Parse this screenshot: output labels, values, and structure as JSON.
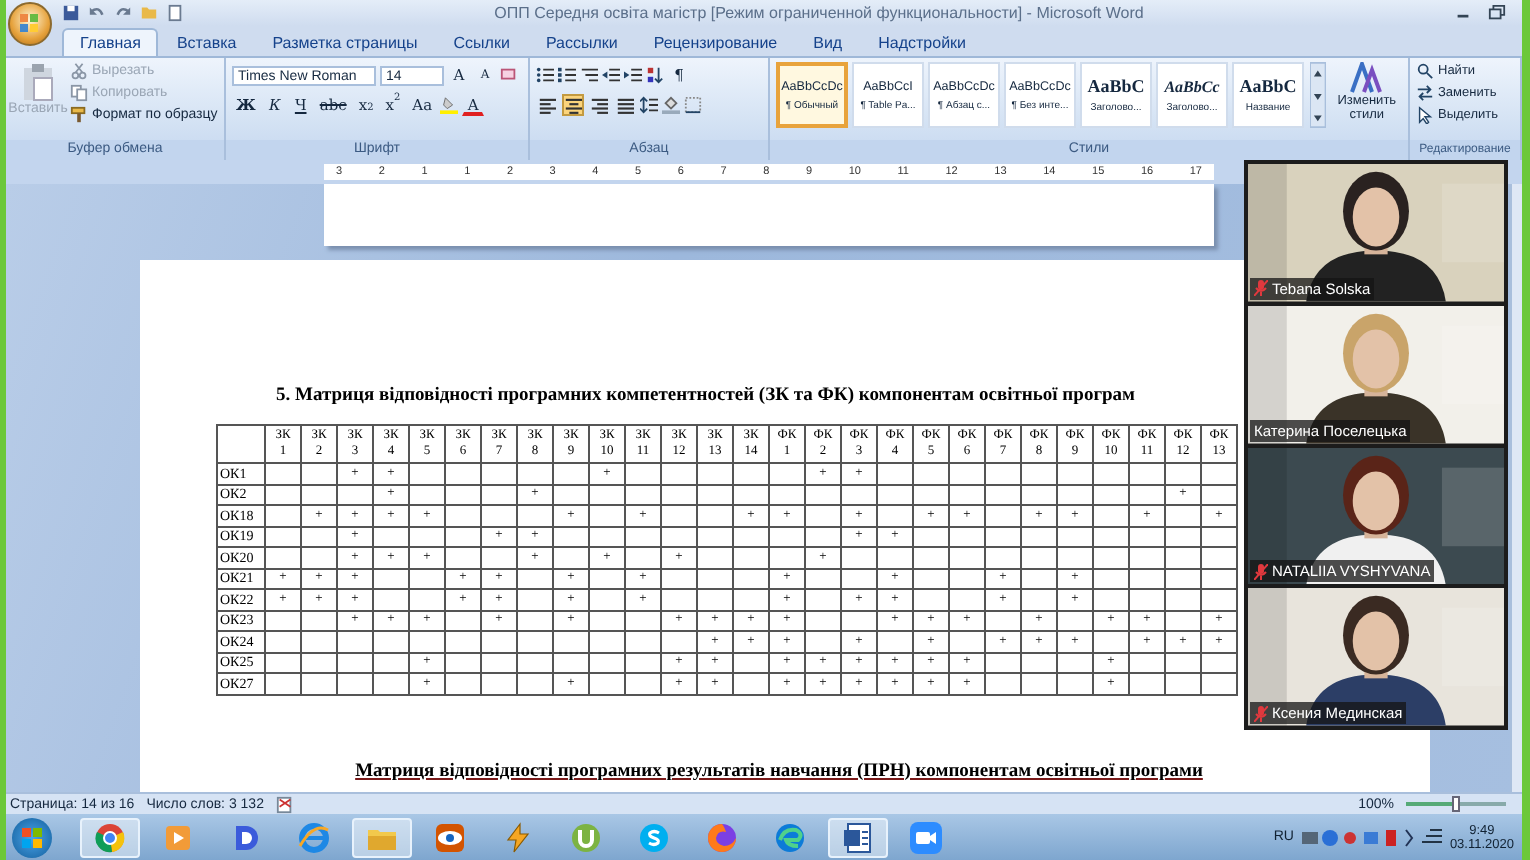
{
  "window": {
    "title": "ОПП Середня освіта магістр [Режим ограниченной функциональности] - Microsoft Word"
  },
  "tabs": [
    {
      "label": "Главная",
      "selected": true
    },
    {
      "label": "Вставка",
      "selected": false
    },
    {
      "label": "Разметка страницы",
      "selected": false
    },
    {
      "label": "Ссылки",
      "selected": false
    },
    {
      "label": "Рассылки",
      "selected": false
    },
    {
      "label": "Рецензирование",
      "selected": false
    },
    {
      "label": "Вид",
      "selected": false
    },
    {
      "label": "Надстройки",
      "selected": false
    }
  ],
  "ribbon": {
    "clipboard": {
      "label": "Буфер обмена",
      "items": [
        {
          "kind": "paste",
          "label": "Вставить",
          "disabled": true
        },
        {
          "kind": "cut",
          "label": "Вырезать",
          "disabled": true
        },
        {
          "kind": "copy",
          "label": "Копировать",
          "disabled": true
        },
        {
          "kind": "painter",
          "label": "Формат по образцу",
          "disabled": false
        }
      ]
    },
    "font": {
      "label": "Шрифт",
      "font_name": "Times New Roman",
      "font_size": "14",
      "grow": "A",
      "shrink": "A",
      "buttons": [
        {
          "kind": "bold",
          "text": "Ж"
        },
        {
          "kind": "italic",
          "text": "К"
        },
        {
          "kind": "underline",
          "text": "Ч"
        },
        {
          "kind": "strike",
          "text": "abc"
        },
        {
          "kind": "sub",
          "text": "x$_{2}$"
        },
        {
          "kind": "sup",
          "text": "x$^{2}$"
        },
        {
          "kind": "case",
          "text": "Aa"
        }
      ],
      "font_color": "A"
    },
    "paragraph": {
      "label": "Абзац",
      "pilcrow": "¶",
      "alignment": [
        {
          "kind": "left",
          "selected": false
        },
        {
          "kind": "center",
          "selected": true
        },
        {
          "kind": "right",
          "selected": false
        },
        {
          "kind": "justify",
          "selected": false
        }
      ]
    },
    "styles": {
      "label": "Стили",
      "items": [
        {
          "preview": "AaBbCcDc",
          "name": "¶ Обычный",
          "kind": "body",
          "selected": true
        },
        {
          "preview": "AaBbCcI",
          "name": "¶ Table Pa...",
          "kind": "body",
          "selected": false
        },
        {
          "preview": "AaBbCcDc",
          "name": "¶ Абзац с...",
          "kind": "body",
          "selected": false
        },
        {
          "preview": "AaBbCcDc",
          "name": "¶ Без инте...",
          "kind": "body",
          "selected": false
        },
        {
          "preview": "AaBbC",
          "name": "Заголово...",
          "kind": "heading",
          "selected": false
        },
        {
          "preview": "AaBbCc",
          "name": "Заголово...",
          "kind": "heading-italic",
          "selected": false
        },
        {
          "preview": "AaBbC",
          "name": "Название",
          "kind": "heading",
          "selected": false
        }
      ],
      "change_styles": "Изменить стили"
    },
    "editing": {
      "label": "Редактирование",
      "items": [
        {
          "kind": "find",
          "label": "Найти"
        },
        {
          "kind": "replace",
          "label": "Заменить"
        },
        {
          "kind": "select",
          "label": "Выделить"
        }
      ]
    }
  },
  "ruler": {
    "marks": [
      "3",
      "2",
      "1",
      "1",
      "2",
      "3",
      "4",
      "5",
      "6",
      "7",
      "8",
      "9",
      "10",
      "11",
      "12",
      "13",
      "14",
      "15",
      "16",
      "17"
    ]
  },
  "document": {
    "heading": "5. Матриця відповідності програмних компетентностей (ЗК та ФК) компонентам освітньої програм",
    "table": {
      "columns": [
        {
          "group": "ЗК",
          "number": "1"
        },
        {
          "group": "ЗК",
          "number": "2"
        },
        {
          "group": "ЗК",
          "number": "3"
        },
        {
          "group": "ЗК",
          "number": "4"
        },
        {
          "group": "ЗК",
          "number": "5"
        },
        {
          "group": "ЗК",
          "number": "6"
        },
        {
          "group": "ЗК",
          "number": "7"
        },
        {
          "group": "ЗК",
          "number": "8"
        },
        {
          "group": "ЗК",
          "number": "9"
        },
        {
          "group": "ЗК",
          "number": "10"
        },
        {
          "group": "ЗК",
          "number": "11"
        },
        {
          "group": "ЗК",
          "number": "12"
        },
        {
          "group": "ЗК",
          "number": "13"
        },
        {
          "group": "ЗК",
          "number": "14"
        },
        {
          "group": "ФК",
          "number": "1"
        },
        {
          "group": "ФК",
          "number": "2"
        },
        {
          "group": "ФК",
          "number": "3"
        },
        {
          "group": "ФК",
          "number": "4"
        },
        {
          "group": "ФК",
          "number": "5"
        },
        {
          "group": "ФК",
          "number": "6"
        },
        {
          "group": "ФК",
          "number": "7"
        },
        {
          "group": "ФК",
          "number": "8"
        },
        {
          "group": "ФК",
          "number": "9"
        },
        {
          "group": "ФК",
          "number": "10"
        },
        {
          "group": "ФК",
          "number": "11"
        },
        {
          "group": "ФК",
          "number": "12"
        },
        {
          "group": "ФК",
          "number": "13"
        }
      ],
      "rows": [
        {
          "label": "ОК1",
          "cells": [
            null,
            null,
            "+",
            "+",
            null,
            null,
            null,
            null,
            null,
            "+",
            null,
            null,
            null,
            null,
            null,
            "+",
            "+",
            null,
            null,
            null,
            null,
            null,
            null,
            null,
            null,
            null,
            null
          ]
        },
        {
          "label": "ОК2",
          "cells": [
            null,
            null,
            null,
            "+",
            null,
            null,
            null,
            "+",
            null,
            null,
            null,
            null,
            null,
            null,
            null,
            null,
            null,
            null,
            null,
            null,
            null,
            null,
            null,
            null,
            null,
            "+",
            null
          ]
        },
        {
          "label": "ОК18",
          "cells": [
            null,
            "+",
            "+",
            "+",
            "+",
            null,
            null,
            null,
            "+",
            null,
            "+",
            null,
            null,
            "+",
            "+",
            null,
            "+",
            null,
            "+",
            "+",
            null,
            "+",
            "+",
            null,
            "+",
            null,
            "+"
          ]
        },
        {
          "label": "ОК19",
          "cells": [
            null,
            null,
            "+",
            null,
            null,
            null,
            "+",
            "+",
            null,
            null,
            null,
            null,
            null,
            null,
            null,
            null,
            "+",
            "+",
            null,
            null,
            null,
            null,
            null,
            null,
            null,
            null,
            null
          ]
        },
        {
          "label": "ОК20",
          "cells": [
            null,
            null,
            "+",
            "+",
            "+",
            null,
            null,
            "+",
            null,
            "+",
            null,
            "+",
            null,
            null,
            null,
            "+",
            null,
            null,
            null,
            null,
            null,
            null,
            null,
            null,
            null,
            null,
            null
          ]
        },
        {
          "label": "ОК21",
          "cells": [
            "+",
            "+",
            "+",
            null,
            null,
            "+",
            "+",
            null,
            "+",
            null,
            "+",
            null,
            null,
            null,
            "+",
            null,
            null,
            "+",
            null,
            null,
            "+",
            null,
            "+",
            null,
            null,
            null,
            null
          ]
        },
        {
          "label": "ОК22",
          "cells": [
            "+",
            "+",
            "+",
            null,
            null,
            "+",
            "+",
            null,
            "+",
            null,
            "+",
            null,
            null,
            null,
            "+",
            null,
            "+",
            "+",
            null,
            null,
            "+",
            null,
            "+",
            null,
            null,
            null,
            null
          ]
        },
        {
          "label": "ОК23",
          "cells": [
            null,
            null,
            "+",
            "+",
            "+",
            null,
            "+",
            null,
            "+",
            null,
            null,
            "+",
            "+",
            "+",
            "+",
            null,
            null,
            "+",
            "+",
            "+",
            null,
            "+",
            null,
            "+",
            "+",
            null,
            "+"
          ]
        },
        {
          "label": "ОК24",
          "cells": [
            null,
            null,
            null,
            null,
            null,
            null,
            null,
            null,
            null,
            null,
            null,
            null,
            "+",
            "+",
            "+",
            null,
            "+",
            null,
            "+",
            null,
            "+",
            "+",
            "+",
            null,
            "+",
            "+",
            "+"
          ]
        },
        {
          "label": "ОК25",
          "cells": [
            null,
            null,
            null,
            null,
            "+",
            null,
            null,
            null,
            null,
            null,
            null,
            "+",
            "+",
            null,
            "+",
            "+",
            "+",
            "+",
            "+",
            "+",
            null,
            null,
            null,
            "+",
            null,
            null,
            null
          ]
        },
        {
          "label": "ОК27",
          "cells": [
            null,
            null,
            null,
            null,
            "+",
            null,
            null,
            null,
            "+",
            null,
            null,
            "+",
            "+",
            null,
            "+",
            "+",
            "+",
            "+",
            "+",
            "+",
            null,
            null,
            null,
            "+",
            null,
            null,
            null
          ]
        }
      ]
    },
    "subheading": "Матриця відповідності програмних результатів навчання (ПРН) компонентам освітньої програми"
  },
  "video": {
    "participants": [
      {
        "name": "Tebana Solska",
        "muted": true
      },
      {
        "name": "Катерина Поселецька",
        "muted": false
      },
      {
        "name": "NATALIIA VYSHYVANA",
        "muted": true
      },
      {
        "name": "Ксения Мединская",
        "muted": true
      }
    ]
  },
  "status_bar": {
    "page": "Страница: 14 из 16",
    "words": "Число слов: 3 132",
    "zoom": "100%",
    "zoom_slider": {
      "level": 0.5
    }
  },
  "taskbar": {
    "apps": [
      {
        "kind": "round-browser",
        "active": true
      },
      {
        "kind": "player",
        "active": false
      },
      {
        "kind": "d-app",
        "active": false
      },
      {
        "kind": "e-browser",
        "active": false
      },
      {
        "kind": "folder",
        "active": true
      },
      {
        "kind": "eye",
        "active": false
      },
      {
        "kind": "bolt",
        "active": false
      },
      {
        "kind": "torrent",
        "active": false
      },
      {
        "kind": "chat",
        "active": false
      },
      {
        "kind": "fox-browser",
        "active": false
      },
      {
        "kind": "wave-browser",
        "active": false
      },
      {
        "kind": "document",
        "active": true
      },
      {
        "kind": "camera",
        "active": false
      }
    ],
    "language": "RU",
    "time": "9:49",
    "date": "03.11.2020"
  }
}
